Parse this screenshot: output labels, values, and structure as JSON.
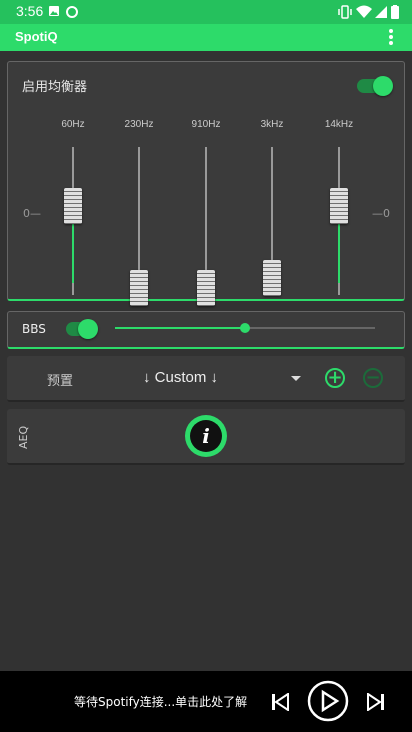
{
  "status_bar": {
    "time": "3:56"
  },
  "app_bar": {
    "title": "SpotiQ"
  },
  "equalizer": {
    "enable_label": "启用均衡器",
    "enabled": true,
    "zero_left": "0",
    "zero_right": "0",
    "bands": [
      {
        "label": "60Hz",
        "level": 0.1
      },
      {
        "label": "230Hz",
        "level": -0.9
      },
      {
        "label": "910Hz",
        "level": -0.9
      },
      {
        "label": "3kHz",
        "level": -0.78
      },
      {
        "label": "14kHz",
        "level": 0.1
      }
    ]
  },
  "bbs": {
    "label": "BBS",
    "enabled": true,
    "level": 0.5
  },
  "preset": {
    "label": "预置",
    "value": "↓ Custom ↓",
    "add_icon": "plus-circle-icon",
    "remove_icon": "minus-circle-icon"
  },
  "aeq": {
    "label": "AEQ",
    "info_icon": "info-icon",
    "info_glyph": "i"
  },
  "player": {
    "message": "等待Spotify连接...单击此处了解",
    "prev_icon": "skip-previous-icon",
    "play_icon": "play-icon",
    "next_icon": "skip-next-icon"
  },
  "colors": {
    "accent": "#2ddb6a",
    "statusbar": "#25c15d",
    "background": "#323232",
    "panel": "#3b3b3b"
  }
}
